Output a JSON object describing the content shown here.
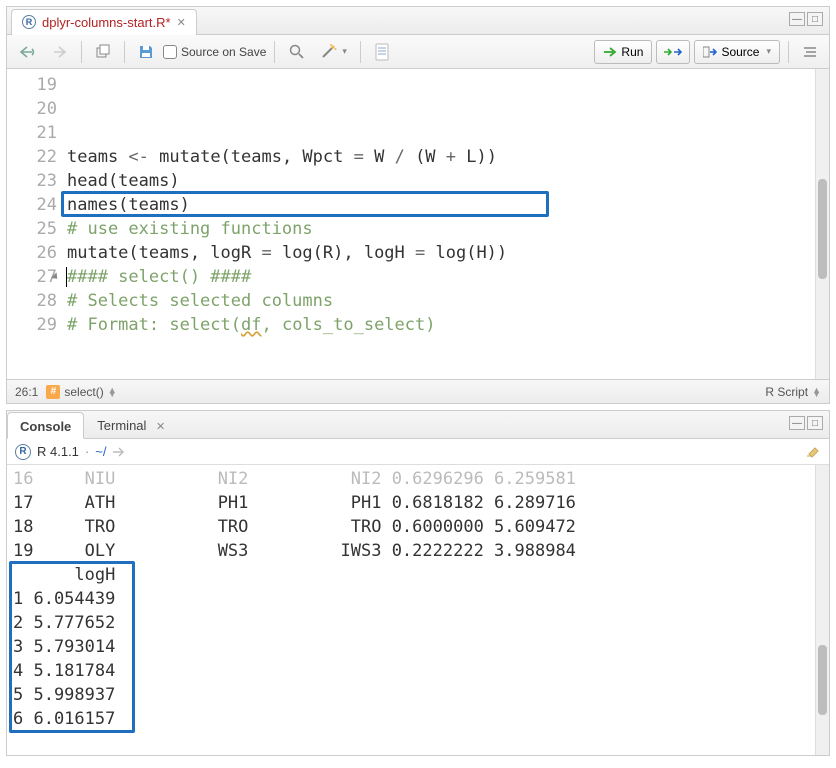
{
  "editor": {
    "tab_filename": "dplyr-columns-start.R*",
    "source_on_save": "Source on Save",
    "run_label": "Run",
    "source_label": "Source",
    "cursor_pos": "26:1",
    "outline_label": "select()",
    "filetype": "R Script",
    "lines": [
      {
        "n": 19,
        "text": "teams <- mutate(teams, Wpct = W / (W + L))"
      },
      {
        "n": 20,
        "text": "head(teams)"
      },
      {
        "n": 21,
        "text": "names(teams)"
      },
      {
        "n": 22,
        "text": ""
      },
      {
        "n": 23,
        "text": "# use existing functions",
        "comment": true
      },
      {
        "n": 24,
        "text": "mutate(teams, logR = log(R), logH = log(H))"
      },
      {
        "n": 25,
        "text": ""
      },
      {
        "n": 26,
        "text": "#### select() ####",
        "comment": true,
        "fold": true,
        "cursor": true
      },
      {
        "n": 27,
        "text": "# Selects selected columns",
        "comment": true
      },
      {
        "n": 28,
        "text": "# Format: select(df, cols_to_select)",
        "comment": true,
        "wavy_df": true
      },
      {
        "n": 29,
        "text": ""
      }
    ],
    "highlight_line": 24
  },
  "console": {
    "tab_console": "Console",
    "tab_terminal": "Terminal",
    "version": "R 4.1.1",
    "path": "~/",
    "faded_row": "16     NIU          NI2          NI2 0.6296296 6.259581",
    "rows_top": [
      "17     ATH          PH1          PH1 0.6818182 6.289716",
      "18     TRO          TRO          TRO 0.6000000 5.609472",
      "19     OLY          WS3         IWS3 0.2222222 3.988984"
    ],
    "logh_header": "      logH",
    "logh_rows": [
      "1 6.054439",
      "2 5.777652",
      "3 5.793014",
      "4 5.181784",
      "5 5.998937",
      "6 6.016157"
    ]
  },
  "icons": {
    "back": "back-icon",
    "fwd": "forward-icon",
    "popout": "popout-icon",
    "save": "save-icon",
    "search": "search-icon",
    "wand": "wand-icon",
    "notebook": "notebook-icon",
    "rerun": "rerun-icon",
    "outline": "outline-icon"
  }
}
